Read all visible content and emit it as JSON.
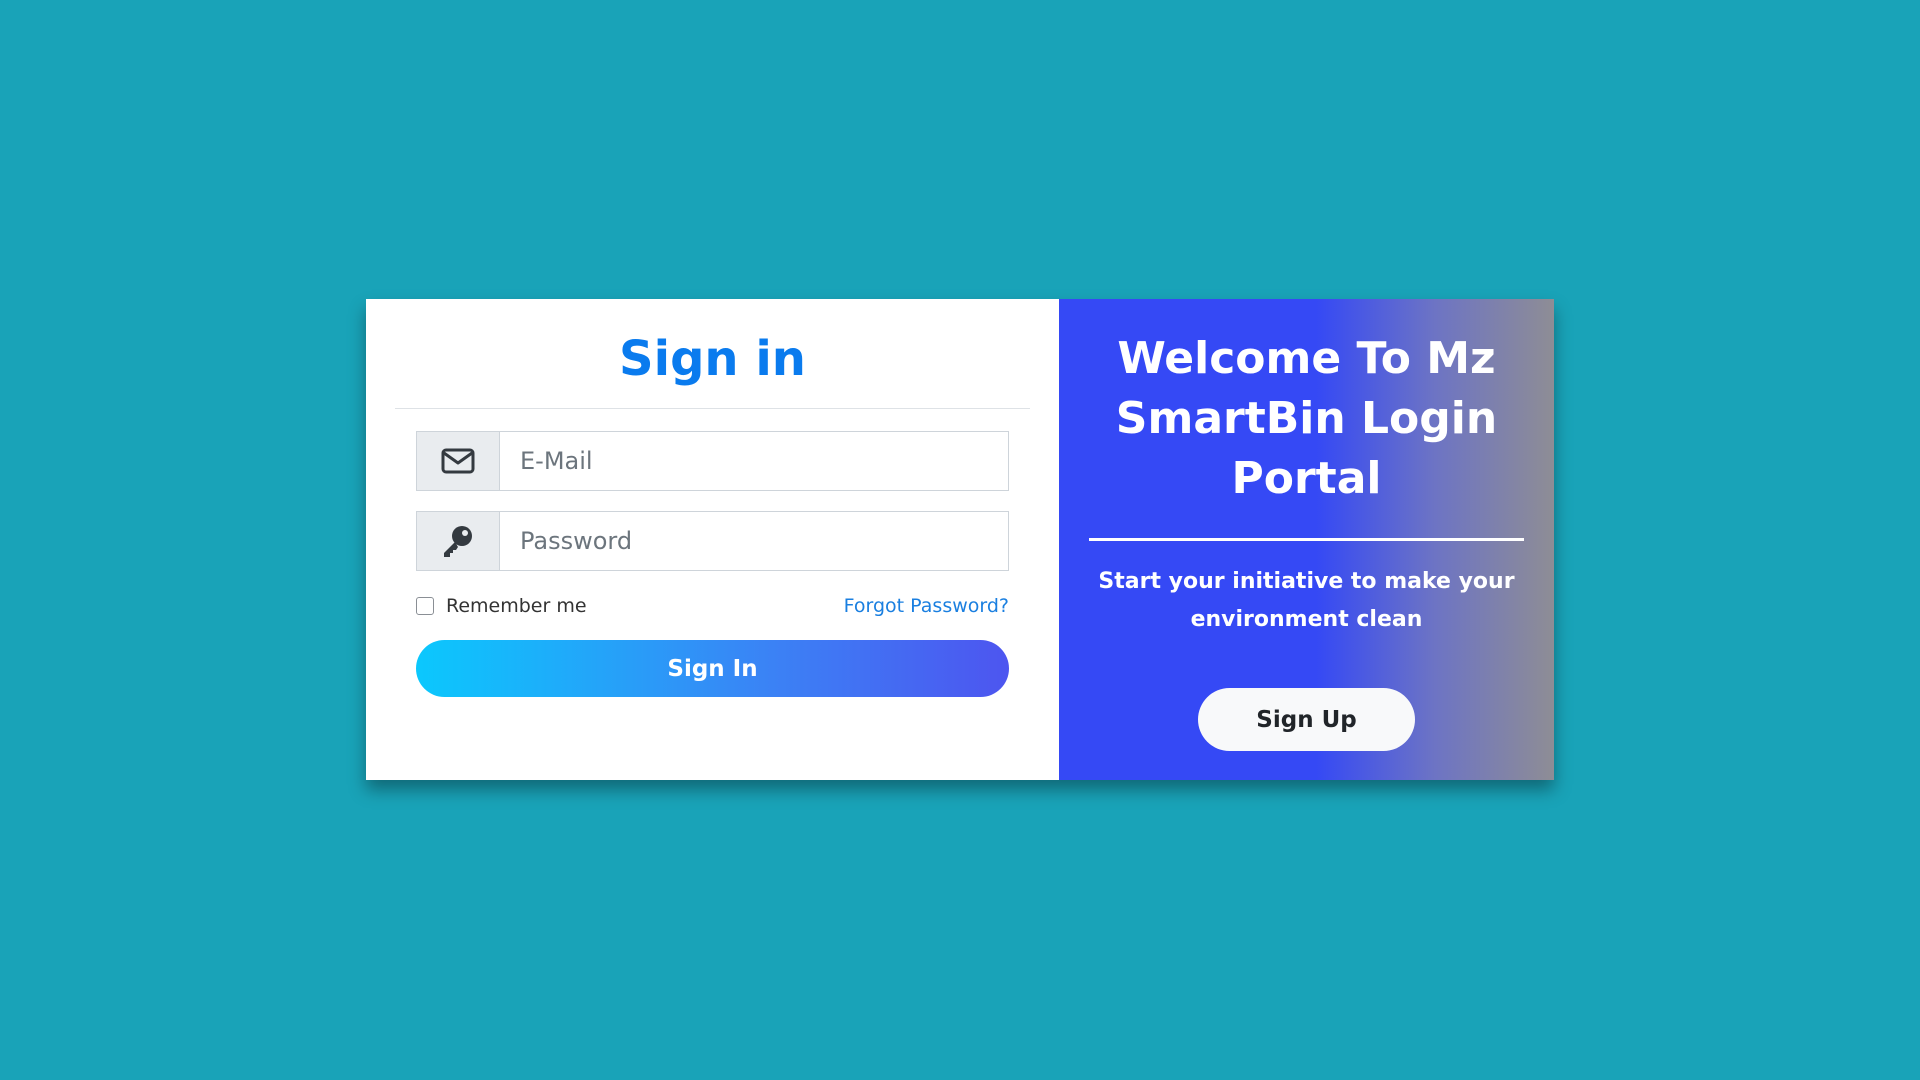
{
  "signin": {
    "title": "Sign in",
    "email": {
      "placeholder": "E-Mail",
      "icon": "envelope-icon"
    },
    "password": {
      "placeholder": "Password",
      "icon": "key-icon"
    },
    "remember_label": "Remember me",
    "forgot_label": "Forgot Password?",
    "button_label": "Sign In"
  },
  "welcome": {
    "title": "Welcome To Mz SmartBin Login Portal",
    "tagline": "Start your initiative to make your environment clean",
    "signup_label": "Sign Up"
  },
  "colors": {
    "background": "#19a3b8",
    "title_blue": "#0a7bee",
    "link_blue": "#1a7fe0",
    "panel_blue": "#3549f5"
  }
}
